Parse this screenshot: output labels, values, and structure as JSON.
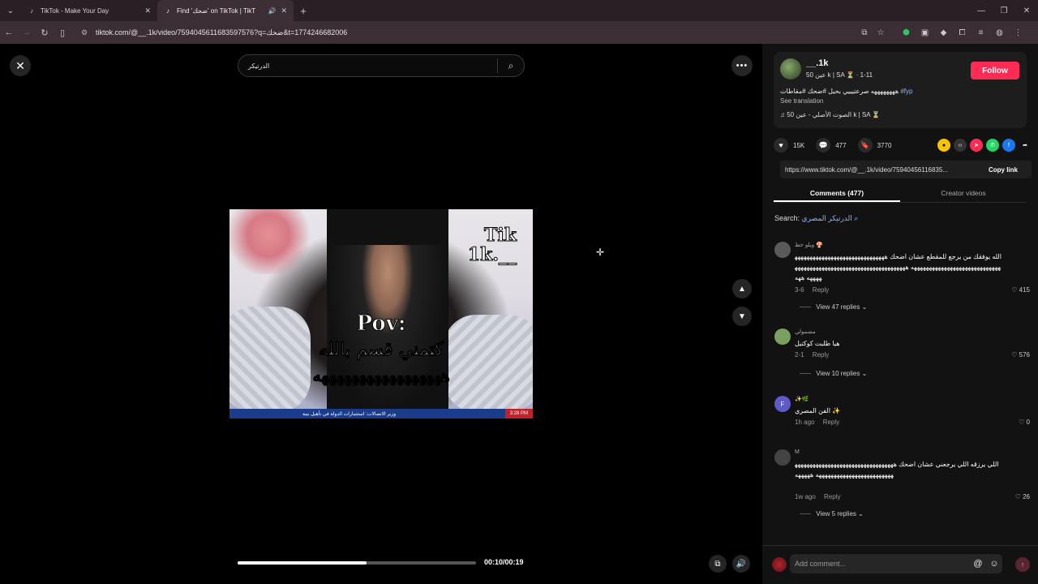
{
  "browser": {
    "tabs": [
      {
        "title": "TikTok - Make Your Day",
        "active": false
      },
      {
        "title": "Find 'ضحك' on TikTok | TikT",
        "active": true
      }
    ],
    "url": "tiktok.com/@__.1k/video/7594045611683597576?q=ضحك&t=1774246682006"
  },
  "video": {
    "search_query": "الدرتيكر",
    "watermark_line1": "Tik",
    "watermark_line2": "1k.__",
    "caption_line1": "Pov:",
    "caption_line2": "كتمني قسم بالله",
    "caption_line3": "هههههههههههههههههه",
    "ticker_text": "وزير الاتصالات: استثمارات الدولة في تأهيل بنية",
    "ticker_time": "3:28 PM",
    "progress": 0.54,
    "time": "00:10/00:19"
  },
  "creator": {
    "username": "__.1k",
    "subtitle": "50 عين k | SA ⏳ · 1-11",
    "follow_label": "Follow",
    "description": "ههههههههه صرعتيييي بحيل #ضحك #مقاطات",
    "hashtag": "#fyp",
    "see_translation": "See translation",
    "music": "الصوت الأصلي - عين 50 k | SA ⏳"
  },
  "stats": {
    "likes": "15K",
    "comments": "477",
    "saves": "3770"
  },
  "share": {
    "link": "https://www.tiktok.com/@__.1k/video/75940456116835...",
    "copy_label": "Copy link"
  },
  "panel_tabs": {
    "comments": "Comments (477)",
    "creator_videos": "Creator videos"
  },
  "comment_search": {
    "label": "Search:",
    "term": "الدرتيكر المصري"
  },
  "comments": [
    {
      "author": "ويلو خط 🍄",
      "text": "الله يوفقك من يرجع للمقطع عشان اضحك ههههههههههههههههههههههههههههههههههههههههههههههههههههههههههههه ههههههههههههههههههههههههههههههههههههههههههه ههه",
      "date": "3-6",
      "reply": "Reply",
      "likes": "415",
      "view_replies": "View 47 replies"
    },
    {
      "author": "مشمولي",
      "text": "هيا طلبت كوكتيل",
      "date": "2-1",
      "reply": "Reply",
      "likes": "576",
      "view_replies": "View 10 replies"
    },
    {
      "author": "✨🌿",
      "text": "الفن المصري ✨",
      "date": "1h ago",
      "reply": "Reply",
      "likes": "0",
      "view_replies": ""
    },
    {
      "author": "M",
      "text": "اللي يرزقه اللي يرجعني عشان اضحك هههههههههههههههههههههههههههههههههههههههههههههههههههههههههههه هههههه",
      "date": "1w ago",
      "reply": "Reply",
      "likes": "26",
      "view_replies": "View 5 replies"
    }
  ],
  "compose": {
    "placeholder": "Add comment..."
  }
}
